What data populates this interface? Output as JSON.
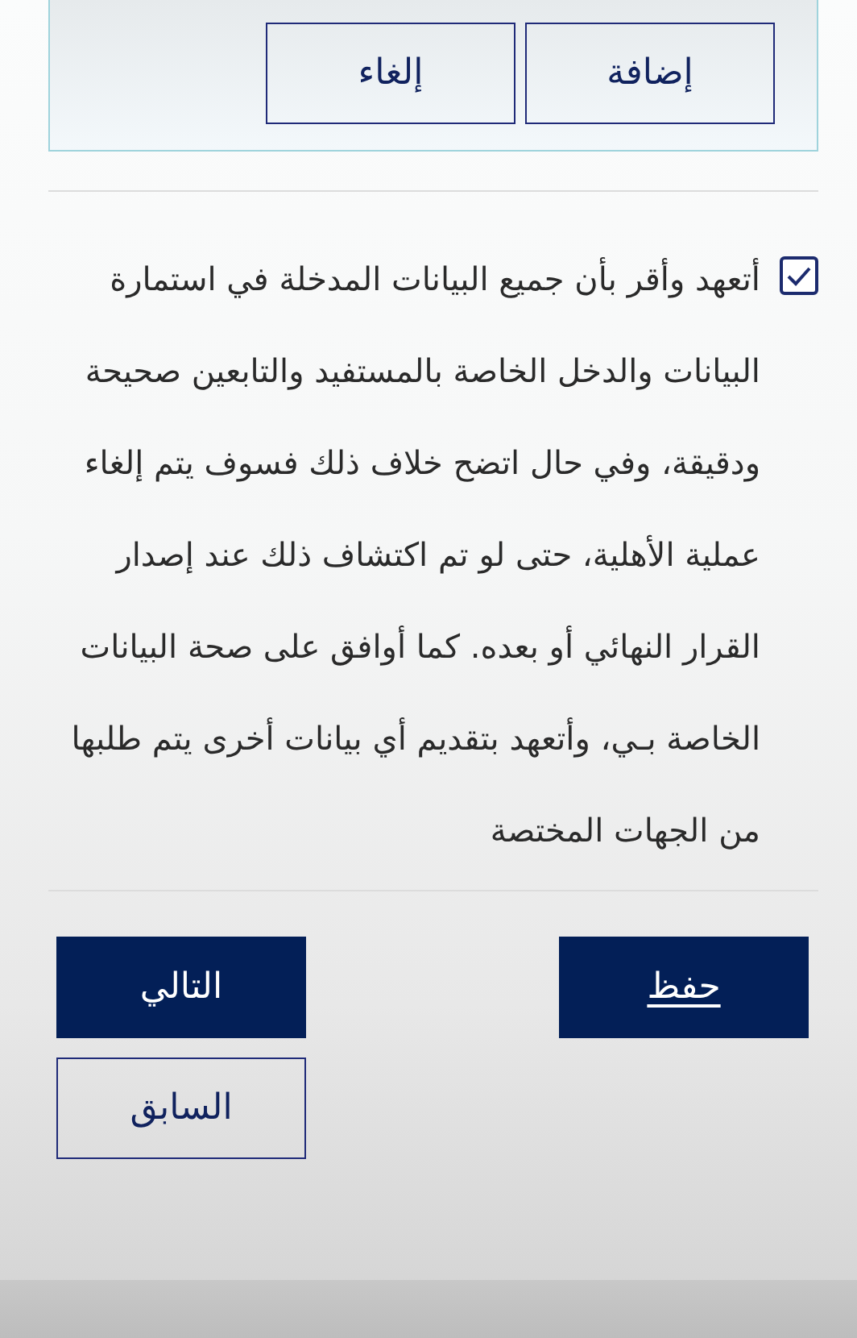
{
  "entry_panel": {
    "buttons": [
      {
        "label": "إضافة",
        "kind": "outline"
      },
      {
        "label": "إلغاء",
        "kind": "outline"
      }
    ]
  },
  "declaration": {
    "checked": true,
    "text": "أتعهد وأقر بأن جميع البيانات المدخلة في استمارة البيانات والدخل الخاصة بالمستفيد والتابعين صحيحة ودقيقة، وفي حال اتضح خلاف ذلك فسوف يتم إلغاء عملية الأهلية، حتى لو تم اكتشاف ذلك عند إصدار القرار النهائي أو بعده. كما أوافق على صحة البيانات الخاصة بـي، وأتعهد بتقديم أي بيانات أخرى يتم طلبها من الجهات المختصة"
  },
  "save_button": {
    "label": "حفظ"
  },
  "nav_buttons": [
    {
      "label": "التالي",
      "kind": "filled"
    },
    {
      "label": "السابق",
      "kind": "outline"
    }
  ]
}
